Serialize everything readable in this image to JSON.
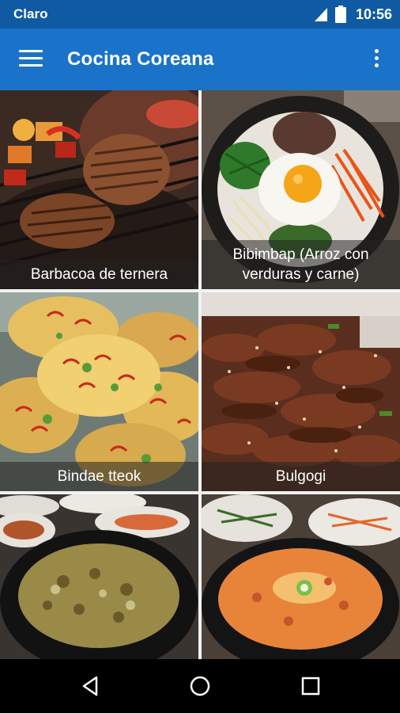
{
  "status_bar": {
    "carrier": "Claro",
    "time": "10:56",
    "icons": [
      "signal-icon",
      "battery-icon"
    ]
  },
  "app_bar": {
    "title": "Cocina Coreana",
    "menu_icon": "menu-icon",
    "overflow_icon": "more-vert-icon",
    "color": "#1a73c8"
  },
  "tiles": [
    {
      "caption": "Barbacoa de ternera"
    },
    {
      "caption": "Bibimbap (Arroz con verduras y carne)"
    },
    {
      "caption": "Bindae tteok"
    },
    {
      "caption": "Bulgogi"
    },
    {
      "caption": ""
    },
    {
      "caption": ""
    }
  ],
  "nav_bar": {
    "icons": [
      "back-icon",
      "home-icon",
      "recents-icon"
    ]
  }
}
